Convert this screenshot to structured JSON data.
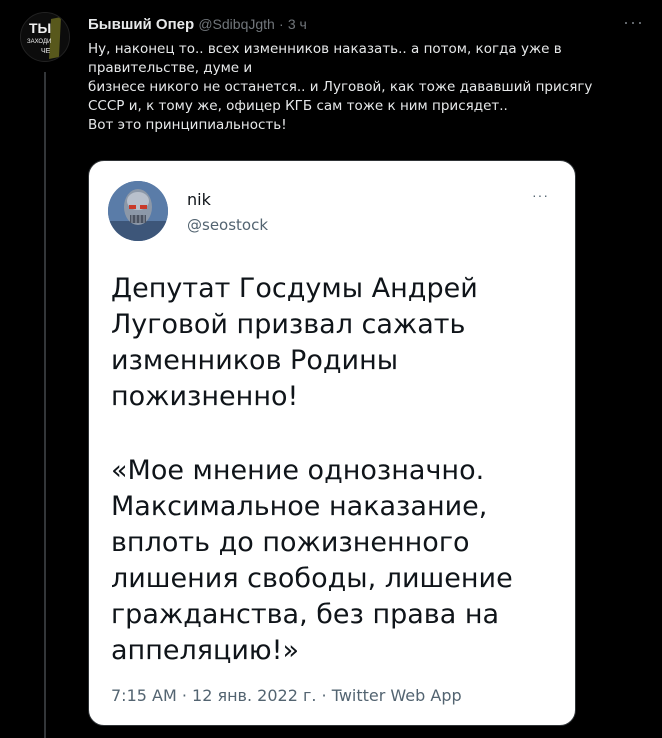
{
  "tweet": {
    "author_name": "Бывший Опер",
    "author_handle": "@SdibqJgth",
    "separator": "·",
    "time": "3 ч",
    "more_label": "···",
    "avatar_text": [
      "ТЫ",
      "ЗАХОДИ",
      "ЧЕ"
    ],
    "text_lines": [
      "Ну, наконец то.. всех изменников наказать.. а потом, когда уже в",
      "правительстве, думе и",
      "бизнесе никого не останется.. и Луговой, как тоже дававший присягу",
      "СССР и, к тому же, офицер КГБ сам тоже к ним присядет..",
      "Вот это принципиальность!"
    ]
  },
  "embed": {
    "name": "nik",
    "handle": "@seostock",
    "more_label": "···",
    "body_lines_1": [
      "Депутат Госдумы Андрей",
      "Луговой призвал сажать",
      "изменников Родины",
      "пожизненно!"
    ],
    "body_lines_2": [
      "«Мое мнение однозначно.",
      "Максимальное наказание,",
      "вплоть до пожизненного",
      "лишения свободы, лишение",
      "гражданства, без права на",
      "аппеляцию!»"
    ],
    "meta": "7:15 AM · 12 янв. 2022 г. · Twitter Web App"
  }
}
